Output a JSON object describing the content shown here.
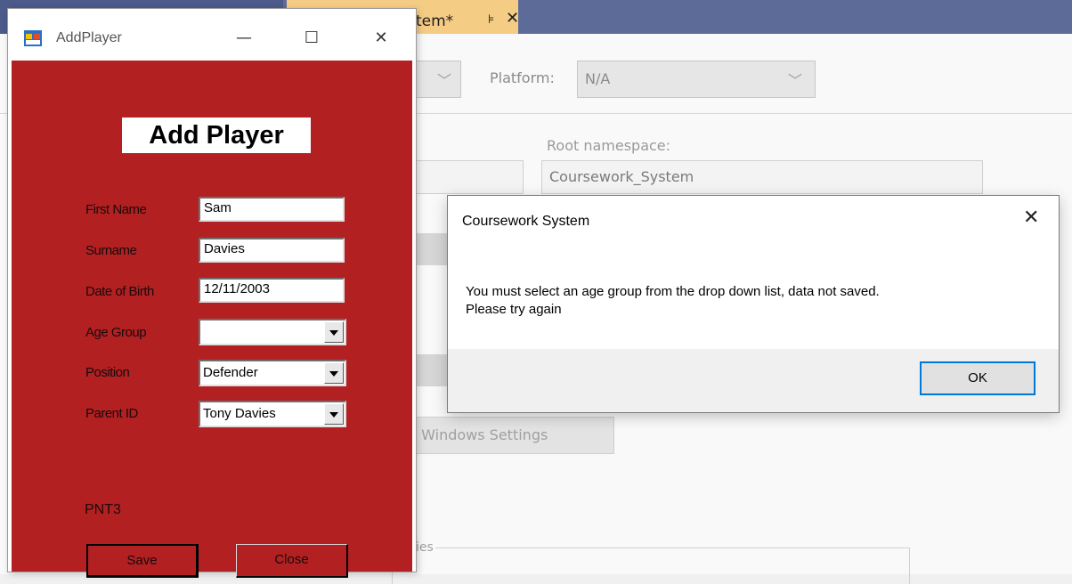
{
  "ide": {
    "tab_active_label": "tem*",
    "tab_pin": "⊧",
    "tab_close": "✕",
    "platform_label": "Platform:",
    "platform_value": "N/A",
    "root_namespace_label": "Root namespace:",
    "root_namespace_value": "Coursework_System",
    "windows_settings_label": "w Windows Settings",
    "group_label": "ies"
  },
  "addplayer": {
    "title": "AddPlayer",
    "heading": "Add Player",
    "fields": {
      "first_name_label": "First Name",
      "first_name_value": "Sam",
      "surname_label": "Surname",
      "surname_value": "Davies",
      "dob_label": "Date of Birth",
      "dob_value": "12/11/2003",
      "age_group_label": "Age Group",
      "age_group_value": "",
      "position_label": "Position",
      "position_value": "Defender",
      "parent_id_label": "Parent ID",
      "parent_id_value": "Tony Davies"
    },
    "player_code": "PNT3",
    "save_label": "Save",
    "close_label": "Close"
  },
  "message_box": {
    "title": "Coursework System",
    "text_line1": "You must select an age group from the drop down list, data not saved.",
    "text_line2": "Please try again",
    "ok_label": "OK"
  }
}
